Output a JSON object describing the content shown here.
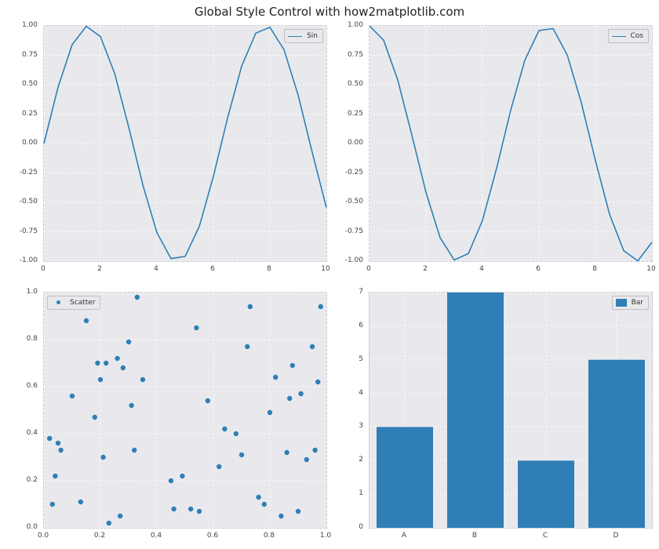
{
  "title": "Global Style Control with how2matplotlib.com",
  "colors": {
    "series": "#2f7fb6",
    "axes_bg": "#e9e9ed"
  },
  "chart_data": [
    {
      "id": "sin",
      "type": "line",
      "legend": "Sin",
      "legend_pos": "top-right",
      "xlabel": "",
      "ylabel": "",
      "xlim": [
        0,
        10
      ],
      "ylim": [
        -1.0,
        1.0
      ],
      "xticks": [
        0,
        2,
        4,
        6,
        8,
        10
      ],
      "yticks": [
        -1.0,
        -0.75,
        -0.5,
        -0.25,
        0.0,
        0.25,
        0.5,
        0.75,
        1.0
      ],
      "series": [
        {
          "name": "Sin",
          "x": [
            0,
            0.5,
            1,
            1.5,
            2,
            2.5,
            3,
            3.5,
            4,
            4.5,
            5,
            5.5,
            6,
            6.5,
            7,
            7.5,
            8,
            8.5,
            9,
            9.5,
            10
          ],
          "y": [
            0.0,
            0.479,
            0.841,
            0.997,
            0.909,
            0.599,
            0.141,
            -0.351,
            -0.757,
            -0.978,
            -0.959,
            -0.706,
            -0.279,
            0.215,
            0.657,
            0.938,
            0.989,
            0.798,
            0.412,
            -0.075,
            -0.544
          ]
        }
      ]
    },
    {
      "id": "cos",
      "type": "line",
      "legend": "Cos",
      "legend_pos": "top-right",
      "xlabel": "",
      "ylabel": "",
      "xlim": [
        0,
        10
      ],
      "ylim": [
        -1.0,
        1.0
      ],
      "xticks": [
        0,
        2,
        4,
        6,
        8,
        10
      ],
      "yticks": [
        -1.0,
        -0.75,
        -0.5,
        -0.25,
        0.0,
        0.25,
        0.5,
        0.75,
        1.0
      ],
      "series": [
        {
          "name": "Cos",
          "x": [
            0,
            0.5,
            1,
            1.5,
            2,
            2.5,
            3,
            3.5,
            4,
            4.5,
            5,
            5.5,
            6,
            6.5,
            7,
            7.5,
            8,
            8.5,
            9,
            9.5,
            10
          ],
          "y": [
            1.0,
            0.878,
            0.54,
            0.071,
            -0.416,
            -0.801,
            -0.99,
            -0.936,
            -0.654,
            -0.211,
            0.284,
            0.709,
            0.96,
            0.977,
            0.754,
            0.347,
            -0.146,
            -0.602,
            -0.911,
            -0.997,
            -0.839
          ]
        }
      ]
    },
    {
      "id": "scatter",
      "type": "scatter",
      "legend": "Scatter",
      "legend_pos": "top-left",
      "xlabel": "",
      "ylabel": "",
      "xlim": [
        0.0,
        1.0
      ],
      "ylim": [
        0.0,
        1.0
      ],
      "xticks": [
        0.0,
        0.2,
        0.4,
        0.6,
        0.8,
        1.0
      ],
      "yticks": [
        0.0,
        0.2,
        0.4,
        0.6,
        0.8,
        1.0
      ],
      "series": [
        {
          "name": "Scatter",
          "points": [
            [
              0.02,
              0.38
            ],
            [
              0.03,
              0.1
            ],
            [
              0.04,
              0.22
            ],
            [
              0.05,
              0.36
            ],
            [
              0.06,
              0.33
            ],
            [
              0.1,
              0.56
            ],
            [
              0.13,
              0.11
            ],
            [
              0.15,
              0.88
            ],
            [
              0.18,
              0.47
            ],
            [
              0.19,
              0.7
            ],
            [
              0.2,
              0.63
            ],
            [
              0.21,
              0.3
            ],
            [
              0.22,
              0.7
            ],
            [
              0.23,
              0.02
            ],
            [
              0.26,
              0.72
            ],
            [
              0.27,
              0.05
            ],
            [
              0.28,
              0.68
            ],
            [
              0.3,
              0.79
            ],
            [
              0.31,
              0.52
            ],
            [
              0.32,
              0.33
            ],
            [
              0.33,
              0.98
            ],
            [
              0.35,
              0.63
            ],
            [
              0.45,
              0.2
            ],
            [
              0.46,
              0.08
            ],
            [
              0.49,
              0.22
            ],
            [
              0.52,
              0.08
            ],
            [
              0.54,
              0.85
            ],
            [
              0.55,
              0.07
            ],
            [
              0.58,
              0.54
            ],
            [
              0.62,
              0.26
            ],
            [
              0.64,
              0.42
            ],
            [
              0.68,
              0.4
            ],
            [
              0.7,
              0.31
            ],
            [
              0.72,
              0.77
            ],
            [
              0.73,
              0.94
            ],
            [
              0.76,
              0.13
            ],
            [
              0.78,
              0.1
            ],
            [
              0.8,
              0.49
            ],
            [
              0.82,
              0.64
            ],
            [
              0.84,
              0.05
            ],
            [
              0.86,
              0.32
            ],
            [
              0.87,
              0.55
            ],
            [
              0.88,
              0.69
            ],
            [
              0.9,
              0.07
            ],
            [
              0.91,
              0.57
            ],
            [
              0.93,
              0.29
            ],
            [
              0.95,
              0.77
            ],
            [
              0.96,
              0.33
            ],
            [
              0.97,
              0.62
            ],
            [
              0.98,
              0.94
            ]
          ]
        }
      ]
    },
    {
      "id": "bar",
      "type": "bar",
      "legend": "Bar",
      "legend_pos": "top-right",
      "xlabel": "",
      "ylabel": "",
      "categories": [
        "A",
        "B",
        "C",
        "D"
      ],
      "values": [
        3,
        7,
        2,
        5
      ],
      "ylim": [
        0,
        7
      ],
      "yticks": [
        0,
        1,
        2,
        3,
        4,
        5,
        6,
        7
      ]
    }
  ]
}
